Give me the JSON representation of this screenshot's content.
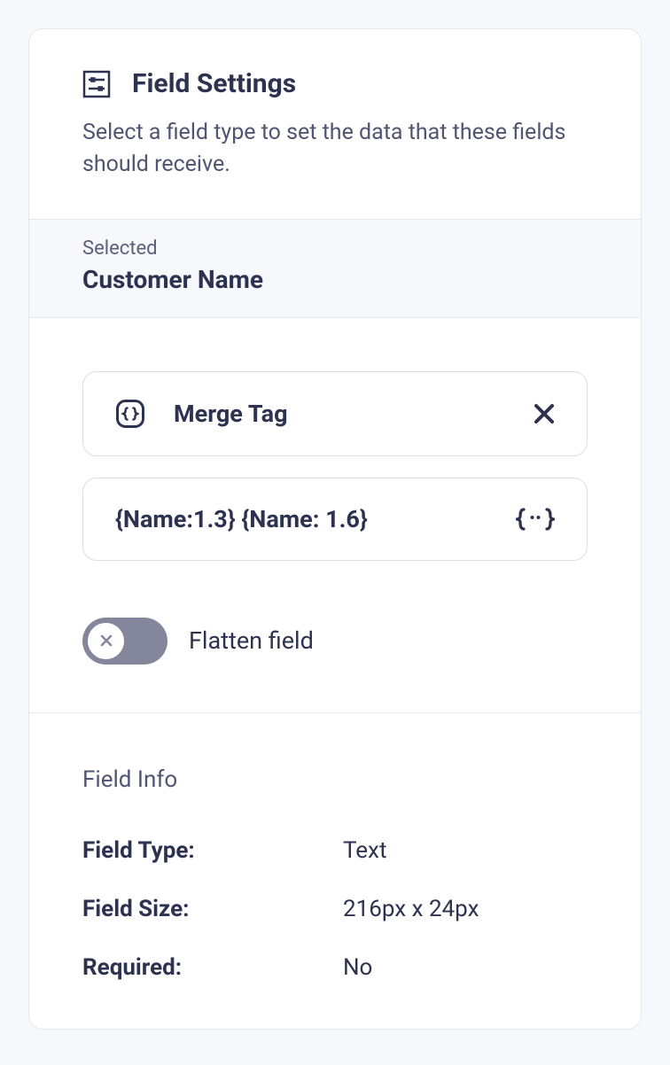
{
  "header": {
    "title": "Field Settings",
    "description": "Select a field type to set the data that these fields should receive."
  },
  "selected": {
    "label": "Selected",
    "value": "Customer Name"
  },
  "mergeTag": {
    "label": "Merge Tag",
    "value": "{Name:1.3} {Name: 1.6}"
  },
  "flatten": {
    "label": "Flatten field"
  },
  "fieldInfo": {
    "title": "Field Info",
    "rows": [
      {
        "key": "Field Type:",
        "val": "Text"
      },
      {
        "key": "Field Size:",
        "val": "216px x 24px"
      },
      {
        "key": "Required:",
        "val": "No"
      }
    ]
  }
}
